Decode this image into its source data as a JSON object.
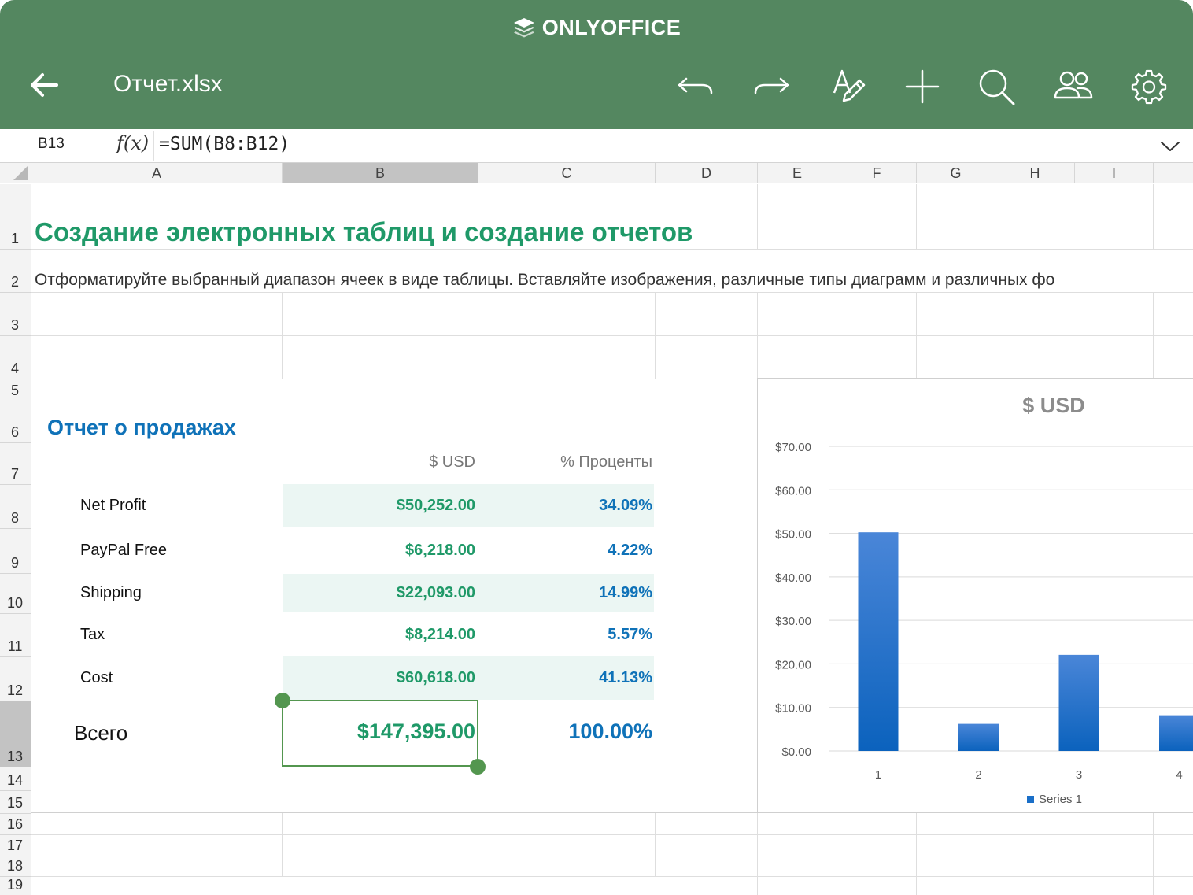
{
  "app": {
    "brand": "ONLYOFFICE",
    "document_title": "Отчет.xlsx"
  },
  "toolbar": {
    "icons": [
      "back-arrow-icon",
      "undo-icon",
      "redo-icon",
      "text-edit-icon",
      "add-icon",
      "search-icon",
      "users-icon",
      "gear-icon"
    ]
  },
  "formula_bar": {
    "cell_ref": "B13",
    "fx_label": "f(x)",
    "formula": "=SUM(B8:B12)"
  },
  "columns": [
    "A",
    "B",
    "C",
    "D",
    "E",
    "F",
    "G",
    "H",
    "I"
  ],
  "rows": [
    "1",
    "2",
    "3",
    "4",
    "5",
    "6",
    "7",
    "8",
    "9",
    "10",
    "11",
    "12",
    "13",
    "14",
    "15",
    "16",
    "17",
    "18",
    "19"
  ],
  "sheet": {
    "title": "Создание электронных таблиц и создание отчетов",
    "subtitle": "Отформатируйте выбранный диапазон ячеек в виде таблицы. Вставляйте изображения, различные типы диаграмм и различных фо",
    "report_title": "Отчет о продажах",
    "header_usd": "$ USD",
    "header_pct": "% Проценты",
    "items": [
      {
        "label": "Net Profit",
        "usd": "$50,252.00",
        "pct": "34.09%"
      },
      {
        "label": "PayPal Free",
        "usd": "$6,218.00",
        "pct": "4.22%"
      },
      {
        "label": "Shipping",
        "usd": "$22,093.00",
        "pct": "14.99%"
      },
      {
        "label": "Tax",
        "usd": "$8,214.00",
        "pct": "5.57%"
      },
      {
        "label": "Cost",
        "usd": "$60,618.00",
        "pct": "41.13%"
      }
    ],
    "total": {
      "label": "Всего",
      "usd": "$147,395.00",
      "pct": "100.00%"
    }
  },
  "colors": {
    "topbar": "#548760",
    "green_text": "#1f9968",
    "blue_text": "#0f72b8",
    "bar": "#1a6fc8"
  },
  "chart_data": {
    "type": "bar",
    "title": "$ USD",
    "categories": [
      "1",
      "2",
      "3",
      "4"
    ],
    "series": [
      {
        "name": "Series 1",
        "values": [
          50.25,
          6.22,
          22.09,
          8.21
        ]
      }
    ],
    "ylim": [
      0,
      70
    ],
    "yticks": [
      "$0.00",
      "$10.00",
      "$20.00",
      "$30.00",
      "$40.00",
      "$50.00",
      "$60.00",
      "$70.00"
    ],
    "grid": true,
    "legend": "bottom"
  }
}
